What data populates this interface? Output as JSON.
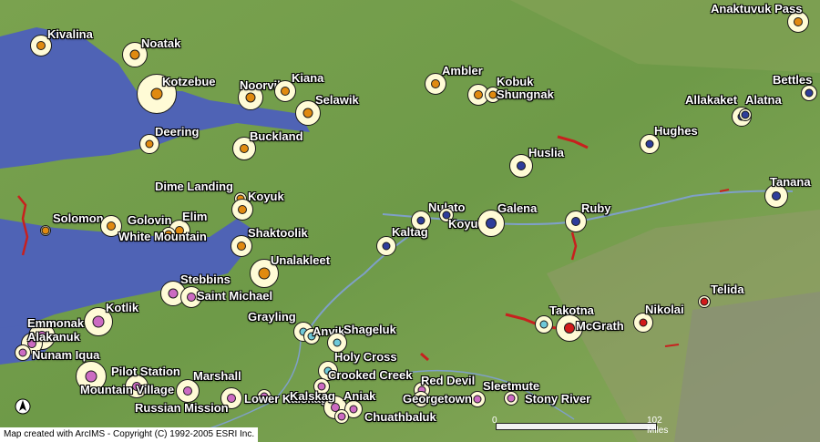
{
  "credit": "Map created with ArcIMS - Copyright (C) 1992-2005 ESRI Inc.",
  "scale_bar": {
    "zero": "0",
    "max": "102 Miles"
  },
  "north_arrow_icon": "north-arrow-icon",
  "colors": {
    "water": "#4f63b5",
    "land": "#6f9a4a",
    "ring": "#fffbd6",
    "orange": "#e08a10",
    "blue": "#2e3d9a",
    "pink": "#cc6bc2",
    "cyan": "#6fc9d9",
    "red": "#d21a1a",
    "river": "#c8201e"
  },
  "towns": [
    {
      "name": "Kivalina",
      "dot": "orange"
    },
    {
      "name": "Noatak",
      "dot": "orange"
    },
    {
      "name": "Kotzebue",
      "dot": "orange"
    },
    {
      "name": "Noorvik",
      "dot": "orange"
    },
    {
      "name": "Kiana",
      "dot": "orange"
    },
    {
      "name": "Selawik",
      "dot": "orange"
    },
    {
      "name": "Deering",
      "dot": "orange"
    },
    {
      "name": "Buckland",
      "dot": "orange"
    },
    {
      "name": "Ambler",
      "dot": "orange"
    },
    {
      "name": "Kobuk",
      "dot": "orange"
    },
    {
      "name": "Shungnak",
      "dot": "orange"
    },
    {
      "name": "Anaktuvuk Pass",
      "dot": "orange"
    },
    {
      "name": "Bettles",
      "dot": "blue"
    },
    {
      "name": "Allakaket",
      "dot": "blue"
    },
    {
      "name": "Alatna",
      "dot": "blue"
    },
    {
      "name": "Hughes",
      "dot": "blue"
    },
    {
      "name": "Huslia",
      "dot": "blue"
    },
    {
      "name": "Tanana",
      "dot": "blue"
    },
    {
      "name": "Dime Landing",
      "dot": "orange"
    },
    {
      "name": "Koyuk",
      "dot": "orange"
    },
    {
      "name": "Solomon",
      "dot": "orange"
    },
    {
      "name": "Golovin",
      "dot": "orange"
    },
    {
      "name": "Elim",
      "dot": "orange"
    },
    {
      "name": "White Mountain",
      "dot": "orange"
    },
    {
      "name": "Shaktoolik",
      "dot": "orange"
    },
    {
      "name": "Nulato",
      "dot": "blue"
    },
    {
      "name": "Koyukuk",
      "dot": "blue"
    },
    {
      "name": "Galena",
      "dot": "blue"
    },
    {
      "name": "Ruby",
      "dot": "blue"
    },
    {
      "name": "Kaltag",
      "dot": "blue"
    },
    {
      "name": "Unalakleet",
      "dot": "orange"
    },
    {
      "name": "Stebbins",
      "dot": "pink"
    },
    {
      "name": "Saint Michael",
      "dot": "pink"
    },
    {
      "name": "Telida",
      "dot": "red"
    },
    {
      "name": "Kotlik",
      "dot": "pink"
    },
    {
      "name": "Grayling",
      "dot": "cyan"
    },
    {
      "name": "Anvik",
      "dot": "cyan"
    },
    {
      "name": "Shageluk",
      "dot": "cyan"
    },
    {
      "name": "Takotna",
      "dot": "cyan"
    },
    {
      "name": "Nikolai",
      "dot": "red"
    },
    {
      "name": "McGrath",
      "dot": "red"
    },
    {
      "name": "Emmonak",
      "dot": "pink"
    },
    {
      "name": "Alakanuk",
      "dot": "pink"
    },
    {
      "name": "Nunam Iqua",
      "dot": "pink"
    },
    {
      "name": "Holy Cross",
      "dot": "cyan"
    },
    {
      "name": "Crooked Creek",
      "dot": "pink"
    },
    {
      "name": "Pilot Station",
      "dot": "pink"
    },
    {
      "name": "Marshall",
      "dot": "pink"
    },
    {
      "name": "Mountain Village",
      "dot": "pink"
    },
    {
      "name": "Red Devil",
      "dot": "pink"
    },
    {
      "name": "Sleetmute",
      "dot": "pink"
    },
    {
      "name": "Georgetown",
      "dot": "pink"
    },
    {
      "name": "Stony River",
      "dot": "pink"
    },
    {
      "name": "Russian Mission",
      "dot": "pink"
    },
    {
      "name": "Lower Kalskag",
      "dot": "pink"
    },
    {
      "name": "Kalskag",
      "dot": "pink"
    },
    {
      "name": "Aniak",
      "dot": "pink"
    },
    {
      "name": "Chuathbaluk",
      "dot": "pink"
    }
  ]
}
